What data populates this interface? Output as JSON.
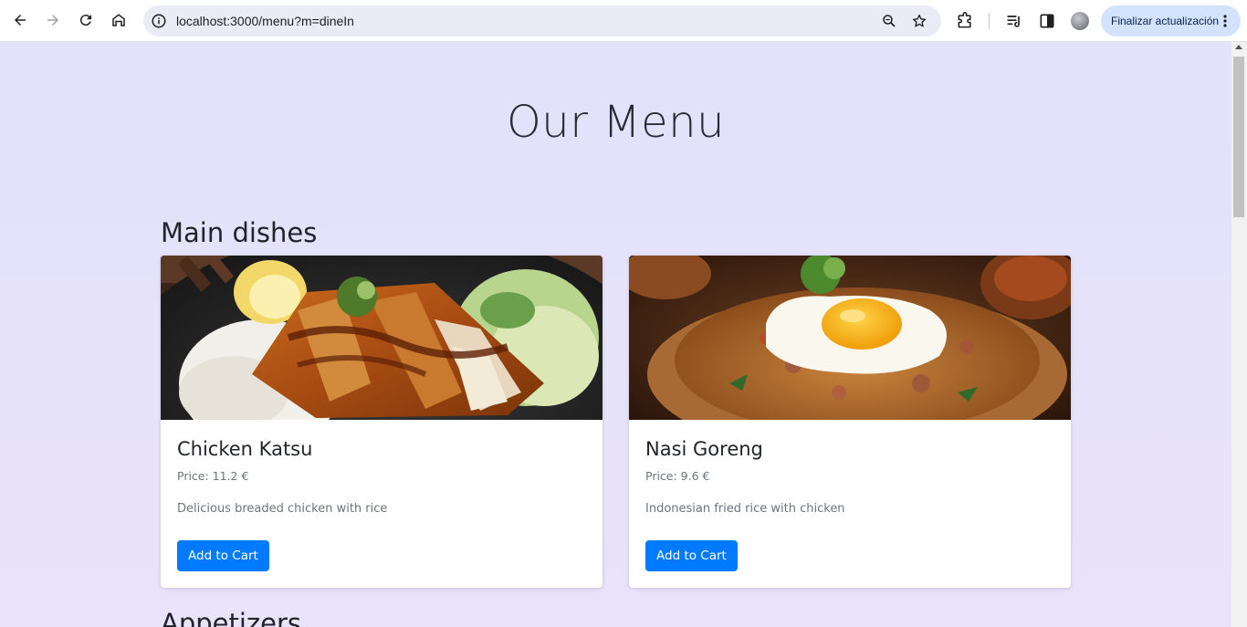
{
  "browser": {
    "url": "localhost:3000/menu?m=dineIn",
    "update_label": "Finalizar actualización"
  },
  "page": {
    "title": "Our Menu",
    "sections": [
      {
        "title": "Main dishes",
        "items": [
          {
            "name": "Chicken Katsu",
            "price": "Price: 11.2 €",
            "description": "Delicious breaded chicken with rice",
            "button": "Add to Cart",
            "image": "chicken-katsu-photo"
          },
          {
            "name": "Nasi Goreng",
            "price": "Price: 9.6 €",
            "description": "Indonesian fried rice with chicken",
            "button": "Add to Cart",
            "image": "nasi-goreng-photo"
          }
        ]
      },
      {
        "title": "Appetizers",
        "items": []
      }
    ]
  },
  "colors": {
    "accent": "#007bff",
    "background": "#e4e2fb"
  }
}
